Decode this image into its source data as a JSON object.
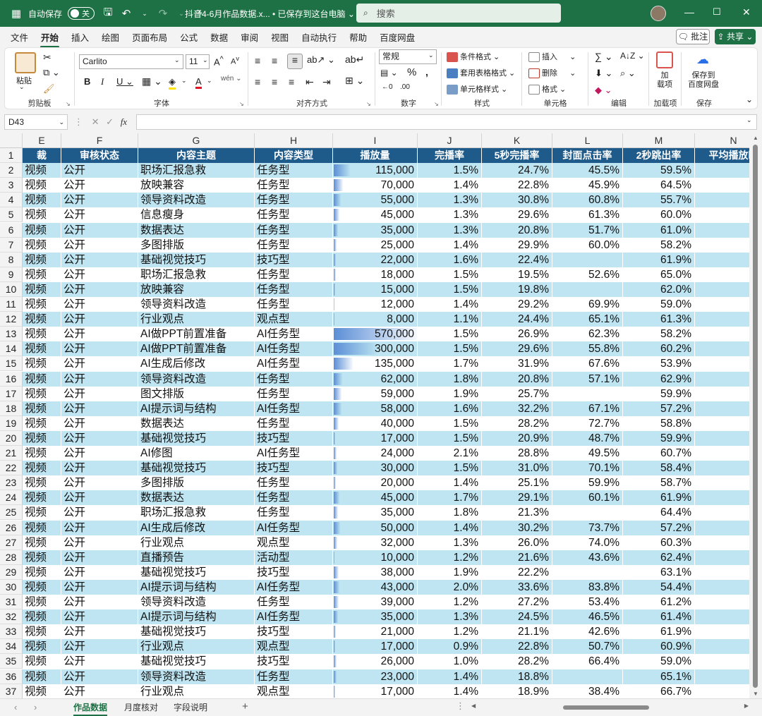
{
  "titlebar": {
    "autosave_label": "自动保存",
    "toggle_state": "关",
    "file_title": "抖音4-6月作品数据.x... • 已保存到这台电脑 ⌄",
    "search_placeholder": "搜索"
  },
  "menu": [
    "文件",
    "开始",
    "插入",
    "绘图",
    "页面布局",
    "公式",
    "数据",
    "审阅",
    "视图",
    "自动执行",
    "帮助",
    "百度网盘"
  ],
  "menu_active": "开始",
  "buttons": {
    "comment": "🗨 批注",
    "share": "⇪ 共享 ⌄"
  },
  "ribbon": {
    "clipboard": {
      "paste": "粘贴",
      "label": "剪贴板"
    },
    "font": {
      "name": "Carlito",
      "size": "11",
      "label": "字体"
    },
    "alignment": {
      "label": "对齐方式"
    },
    "number": {
      "format": "常规",
      "label": "数字"
    },
    "styles": {
      "cond": "条件格式 ⌄",
      "table": "套用表格格式 ⌄",
      "cell": "单元格样式 ⌄",
      "label": "样式"
    },
    "cells": {
      "insert": "插入",
      "delete": "删除",
      "format": "格式 ⌄",
      "label": "单元格"
    },
    "edit": {
      "label": "编辑"
    },
    "addins": {
      "btn": "加\n载项",
      "label": "加载项"
    },
    "save": {
      "btn": "保存到\n百度网盘",
      "label": "保存"
    }
  },
  "formula": {
    "namebox": "D43",
    "fx": "fx"
  },
  "columns": [
    "E",
    "F",
    "G",
    "H",
    "I",
    "J",
    "K",
    "L",
    "M",
    "N"
  ],
  "header_row": [
    "裁",
    "审核状态",
    "内容主题",
    "内容类型",
    "播放量",
    "完播率",
    "5秒完播率",
    "封面点击率",
    "2秒跳出率",
    "平均播放时"
  ],
  "rows": [
    [
      "视频",
      "公开",
      "职场汇报急救",
      "任务型",
      "115,000",
      "1.5%",
      "24.7%",
      "45.5%",
      "59.5%"
    ],
    [
      "视频",
      "公开",
      "放映兼容",
      "任务型",
      "70,000",
      "1.4%",
      "22.8%",
      "45.9%",
      "64.5%"
    ],
    [
      "视频",
      "公开",
      "领导资料改造",
      "任务型",
      "55,000",
      "1.3%",
      "30.8%",
      "60.8%",
      "55.7%"
    ],
    [
      "视频",
      "公开",
      "信息瘦身",
      "任务型",
      "45,000",
      "1.3%",
      "29.6%",
      "61.3%",
      "60.0%"
    ],
    [
      "视频",
      "公开",
      "数据表达",
      "任务型",
      "35,000",
      "1.3%",
      "20.8%",
      "51.7%",
      "61.0%"
    ],
    [
      "视频",
      "公开",
      "多图排版",
      "任务型",
      "25,000",
      "1.4%",
      "29.9%",
      "60.0%",
      "58.2%"
    ],
    [
      "视频",
      "公开",
      "基础视觉技巧",
      "技巧型",
      "22,000",
      "1.6%",
      "22.4%",
      "",
      "61.9%"
    ],
    [
      "视频",
      "公开",
      "职场汇报急救",
      "任务型",
      "18,000",
      "1.5%",
      "19.5%",
      "52.6%",
      "65.0%"
    ],
    [
      "视频",
      "公开",
      "放映兼容",
      "任务型",
      "15,000",
      "1.5%",
      "19.8%",
      "",
      "62.0%"
    ],
    [
      "视频",
      "公开",
      "领导资料改造",
      "任务型",
      "12,000",
      "1.4%",
      "29.2%",
      "69.9%",
      "59.0%"
    ],
    [
      "视频",
      "公开",
      "行业观点",
      "观点型",
      "8,000",
      "1.1%",
      "24.4%",
      "65.1%",
      "61.3%"
    ],
    [
      "视频",
      "公开",
      "AI做PPT前置准备",
      "AI任务型",
      "570,000",
      "1.5%",
      "26.9%",
      "62.3%",
      "58.2%"
    ],
    [
      "视频",
      "公开",
      "AI做PPT前置准备",
      "AI任务型",
      "300,000",
      "1.5%",
      "29.6%",
      "55.8%",
      "60.2%"
    ],
    [
      "视频",
      "公开",
      "AI生成后修改",
      "AI任务型",
      "135,000",
      "1.7%",
      "31.9%",
      "67.6%",
      "53.9%"
    ],
    [
      "视频",
      "公开",
      "领导资料改造",
      "任务型",
      "62,000",
      "1.8%",
      "20.8%",
      "57.1%",
      "62.9%"
    ],
    [
      "视频",
      "公开",
      "图文排版",
      "任务型",
      "59,000",
      "1.9%",
      "25.7%",
      "",
      "59.9%"
    ],
    [
      "视频",
      "公开",
      "AI提示词与结构",
      "AI任务型",
      "58,000",
      "1.6%",
      "32.2%",
      "67.1%",
      "57.2%"
    ],
    [
      "视频",
      "公开",
      "数据表达",
      "任务型",
      "40,000",
      "1.5%",
      "28.2%",
      "72.7%",
      "58.8%"
    ],
    [
      "视频",
      "公开",
      "基础视觉技巧",
      "技巧型",
      "17,000",
      "1.5%",
      "20.9%",
      "48.7%",
      "59.9%"
    ],
    [
      "视频",
      "公开",
      "AI修图",
      "AI任务型",
      "24,000",
      "2.1%",
      "28.8%",
      "49.5%",
      "60.7%"
    ],
    [
      "视频",
      "公开",
      "基础视觉技巧",
      "技巧型",
      "30,000",
      "1.5%",
      "31.0%",
      "70.1%",
      "58.4%"
    ],
    [
      "视频",
      "公开",
      "多图排版",
      "任务型",
      "20,000",
      "1.4%",
      "25.1%",
      "59.9%",
      "58.7%"
    ],
    [
      "视频",
      "公开",
      "数据表达",
      "任务型",
      "45,000",
      "1.7%",
      "29.1%",
      "60.1%",
      "61.9%"
    ],
    [
      "视频",
      "公开",
      "职场汇报急救",
      "任务型",
      "35,000",
      "1.8%",
      "21.3%",
      "",
      "64.4%"
    ],
    [
      "视频",
      "公开",
      "AI生成后修改",
      "AI任务型",
      "50,000",
      "1.4%",
      "30.2%",
      "73.7%",
      "57.2%"
    ],
    [
      "视频",
      "公开",
      "行业观点",
      "观点型",
      "32,000",
      "1.3%",
      "26.0%",
      "74.0%",
      "60.3%"
    ],
    [
      "视频",
      "公开",
      "直播预告",
      "活动型",
      "10,000",
      "1.2%",
      "21.6%",
      "43.6%",
      "62.4%"
    ],
    [
      "视频",
      "公开",
      "基础视觉技巧",
      "技巧型",
      "38,000",
      "1.9%",
      "22.2%",
      "",
      "63.1%"
    ],
    [
      "视频",
      "公开",
      "AI提示词与结构",
      "AI任务型",
      "43,000",
      "2.0%",
      "33.6%",
      "83.8%",
      "54.4%"
    ],
    [
      "视频",
      "公开",
      "领导资料改造",
      "任务型",
      "39,000",
      "1.2%",
      "27.2%",
      "53.4%",
      "61.2%"
    ],
    [
      "视频",
      "公开",
      "AI提示词与结构",
      "AI任务型",
      "35,000",
      "1.3%",
      "24.5%",
      "46.5%",
      "61.4%"
    ],
    [
      "视频",
      "公开",
      "基础视觉技巧",
      "技巧型",
      "21,000",
      "1.2%",
      "21.1%",
      "42.6%",
      "61.9%"
    ],
    [
      "视频",
      "公开",
      "行业观点",
      "观点型",
      "17,000",
      "0.9%",
      "22.8%",
      "50.7%",
      "60.9%"
    ],
    [
      "视频",
      "公开",
      "基础视觉技巧",
      "技巧型",
      "26,000",
      "1.0%",
      "28.2%",
      "66.4%",
      "59.0%"
    ],
    [
      "视频",
      "公开",
      "领导资料改造",
      "任务型",
      "23,000",
      "1.4%",
      "18.8%",
      "",
      "65.1%"
    ],
    [
      "视频",
      "公开",
      "行业观点",
      "观点型",
      "17,000",
      "1.4%",
      "18.9%",
      "38.4%",
      "66.7%"
    ]
  ],
  "play_max": 570000,
  "sheets": [
    "作品数据",
    "月度核对",
    "字段说明"
  ],
  "active_sheet": "作品数据",
  "colors": {
    "excel_green": "#1e7145",
    "header_blue": "#1e5a8a",
    "band": "#bee5f1",
    "databar": "#5b8ed6"
  }
}
